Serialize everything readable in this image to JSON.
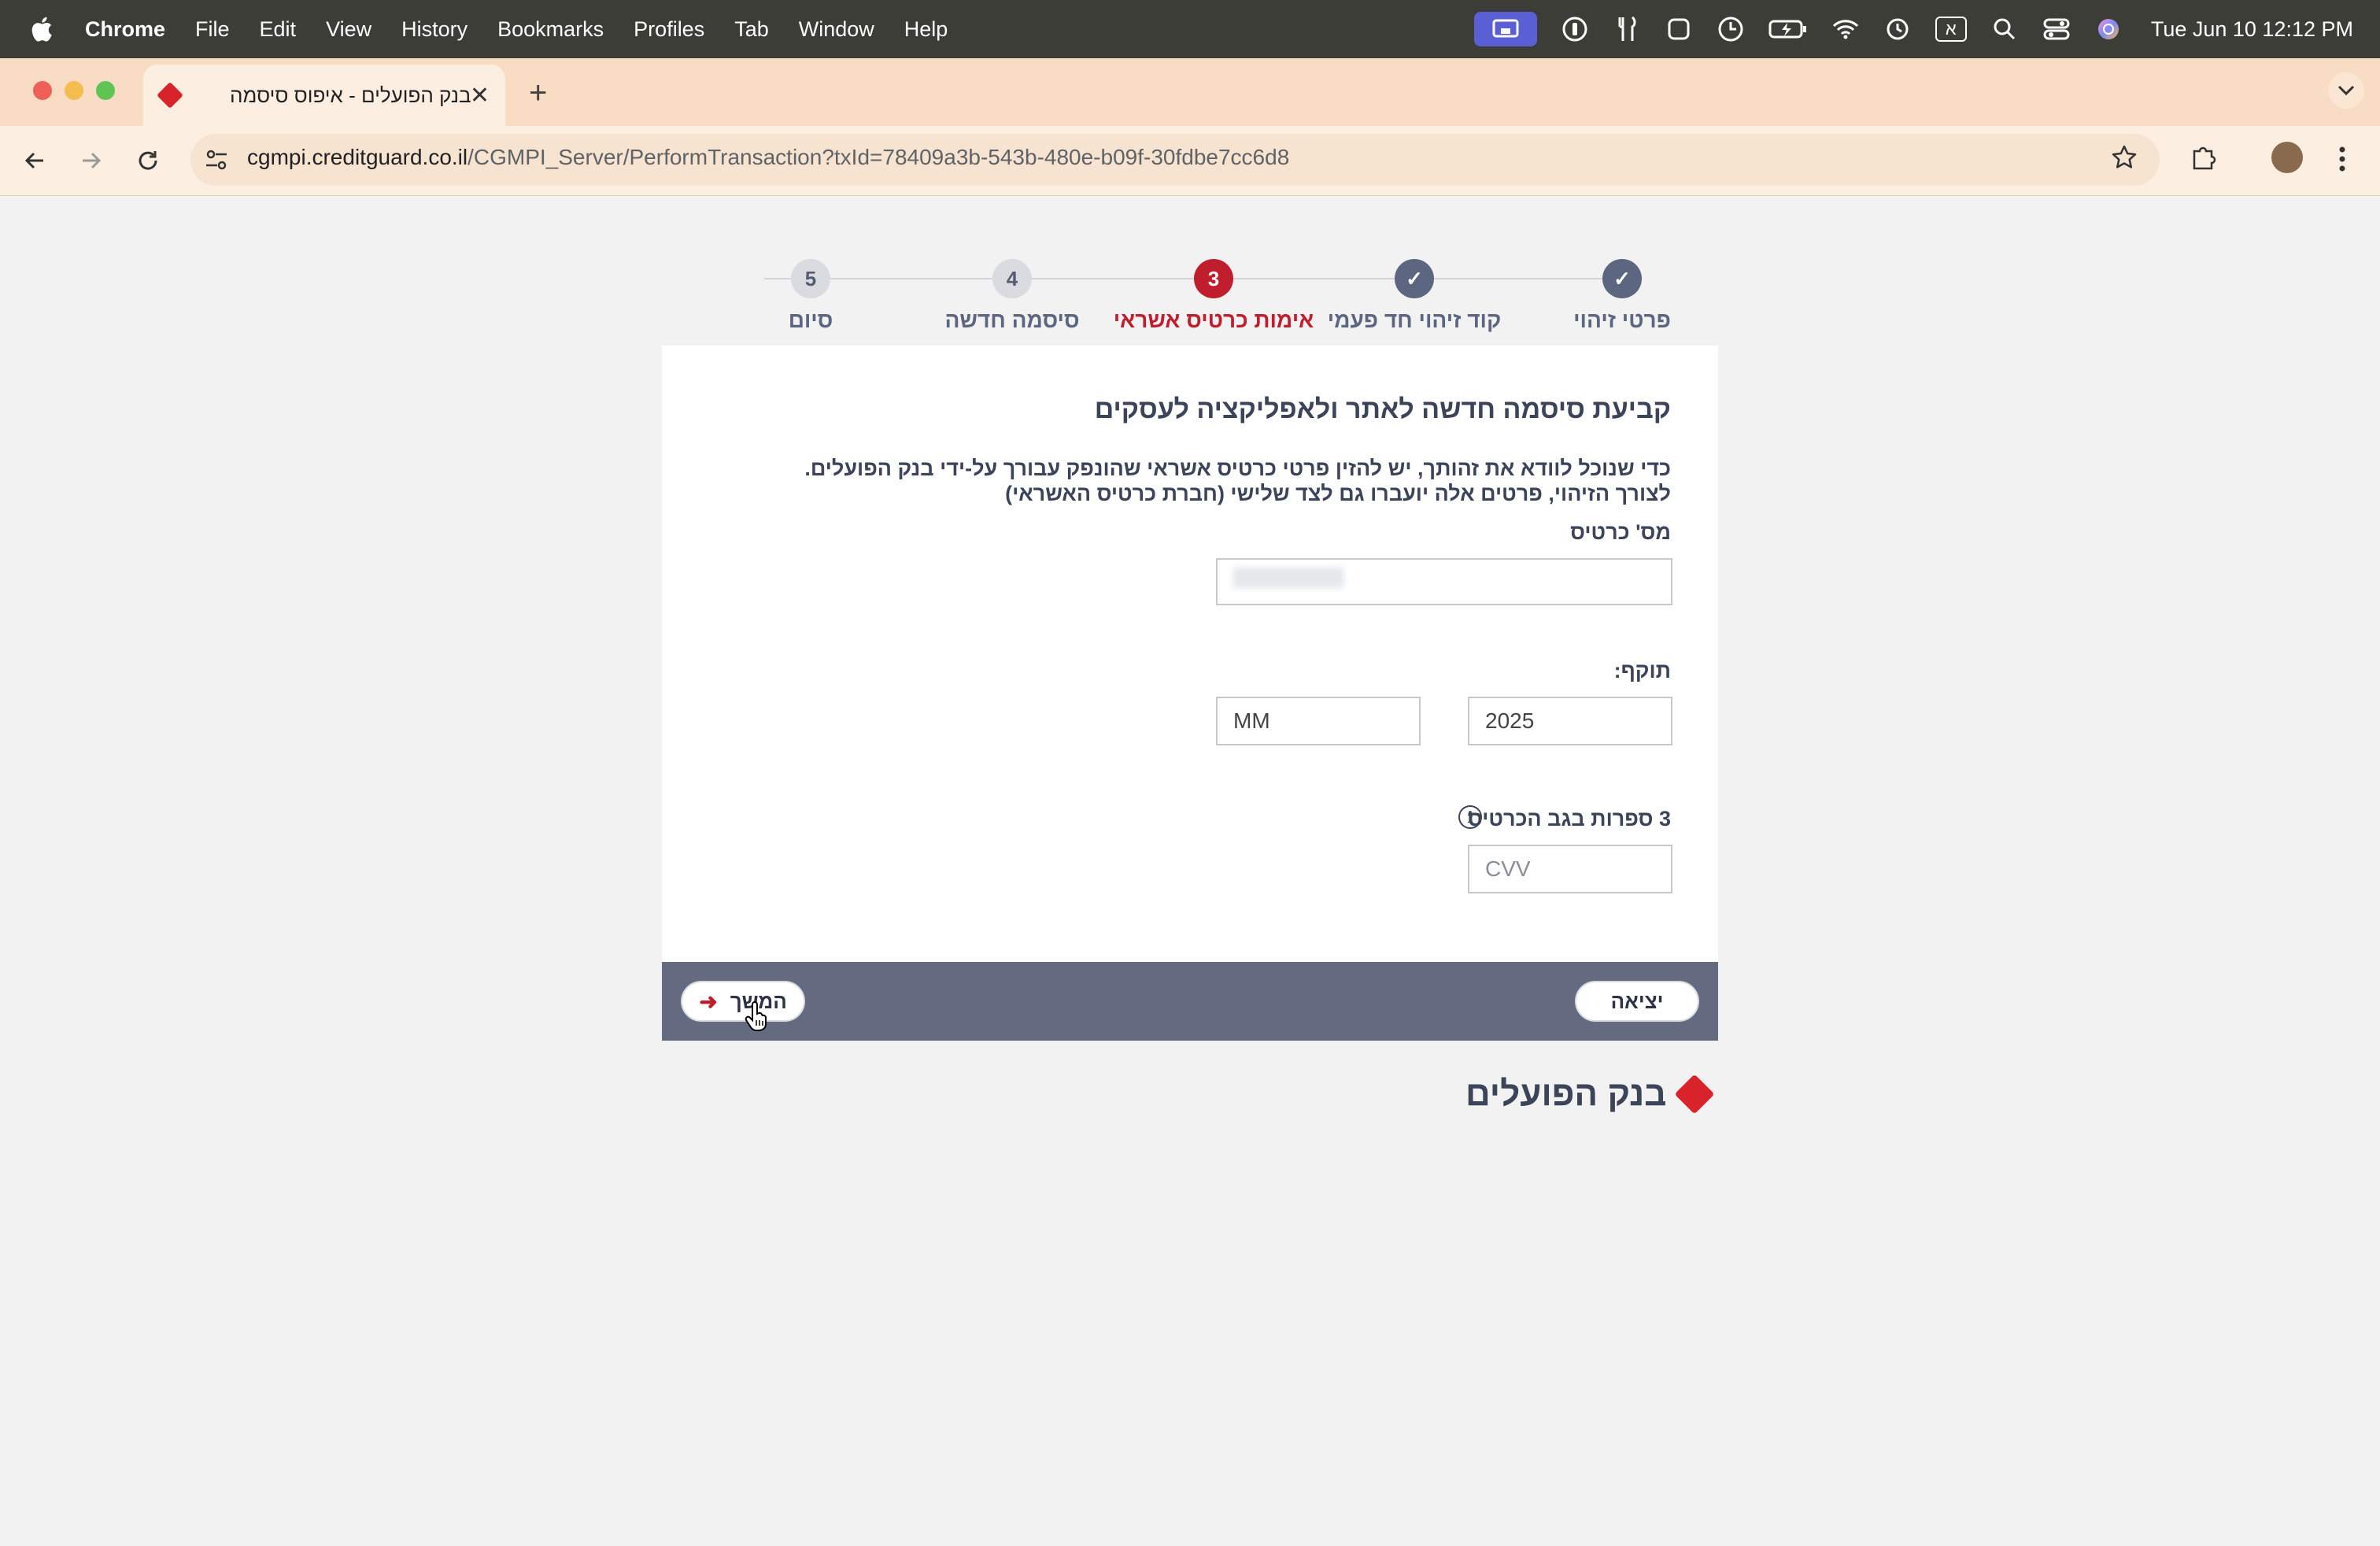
{
  "menubar": {
    "app_name": "Chrome",
    "items": [
      "File",
      "Edit",
      "View",
      "History",
      "Bookmarks",
      "Profiles",
      "Tab",
      "Window",
      "Help"
    ],
    "clock": "Tue Jun 10  12:12 PM",
    "input_source": "א"
  },
  "browser": {
    "tab_title": "בנק הפועלים - איפוס סיסמה",
    "url_host": "cgmpi.creditguard.co.il",
    "url_path": "/CGMPI_Server/PerformTransaction?txId=78409a3b-543b-480e-b09f-30fdbe7cc6d8"
  },
  "stepper": {
    "steps": [
      {
        "number": "✓",
        "label": "פרטי זיהוי",
        "state": "done"
      },
      {
        "number": "✓",
        "label": "קוד זיהוי חד פעמי",
        "state": "done"
      },
      {
        "number": "3",
        "label": "אימות כרטיס אשראי",
        "state": "current"
      },
      {
        "number": "4",
        "label": "סיסמה חדשה",
        "state": "todo"
      },
      {
        "number": "5",
        "label": "סיום",
        "state": "todo"
      }
    ]
  },
  "form": {
    "title": "קביעת סיסמה חדשה לאתר ולאפליקציה לעסקים",
    "description_line1": "כדי שנוכל לוודא את זהותך, יש להזין פרטי כרטיס אשראי שהונפק עבורך על-ידי בנק הפועלים.",
    "description_line2": "לצורך הזיהוי, פרטים אלה יועברו גם לצד שלישי (חברת כרטיס האשראי)",
    "card_number_label": "מס' כרטיס",
    "card_number_value": "",
    "expiry_label": "תוקף:",
    "expiry_year": "2025",
    "expiry_month": "MM",
    "cvv_label": "3 ספרות בגב הכרטיס",
    "cvv_placeholder": "CVV"
  },
  "footer": {
    "exit_label": "יציאה",
    "continue_label": "המשך"
  },
  "brand": {
    "logo_text": "בנק הפועלים",
    "accent_color": "#c01e2d",
    "done_color": "#5d6680"
  }
}
